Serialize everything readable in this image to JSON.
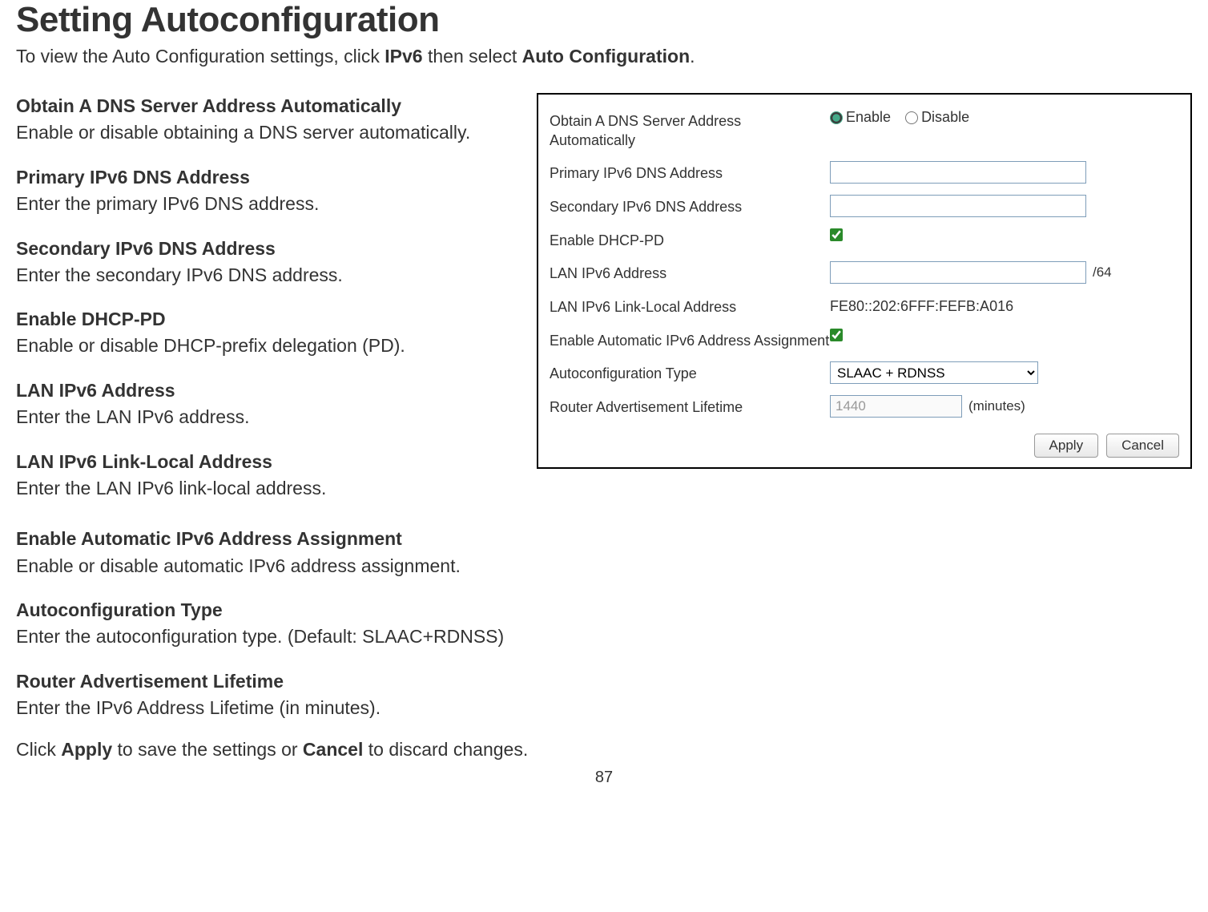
{
  "page": {
    "title": "Setting Autoconfiguration",
    "intro_prefix": "To view the Auto Configuration settings, click ",
    "intro_strong1": "IPv6",
    "intro_mid": " then select ",
    "intro_strong2": "Auto Configuration",
    "intro_suffix": ".",
    "page_number": "87"
  },
  "definitions": [
    {
      "term": "Obtain A DNS Server Address Automatically",
      "desc": "Enable or disable obtaining a DNS server automatically."
    },
    {
      "term": "Primary IPv6 DNS Address",
      "desc": "Enter the primary IPv6 DNS address."
    },
    {
      "term": "Secondary IPv6 DNS Address",
      "desc": "Enter the secondary IPv6 DNS address."
    },
    {
      "term": "Enable DHCP-PD",
      "desc": "Enable or disable DHCP-prefix delegation (PD)."
    },
    {
      "term": "LAN IPv6 Address",
      "desc": "Enter the LAN IPv6 address."
    },
    {
      "term": "LAN IPv6 Link-Local Address",
      "desc": "Enter the LAN IPv6 link-local address."
    },
    {
      "term": "Enable Automatic IPv6 Address Assignment",
      "desc": "Enable or disable automatic IPv6 address assignment."
    },
    {
      "term": "Autoconfiguration Type",
      "desc": "Enter the autoconfiguration type. (Default: SLAAC+RDNSS)"
    },
    {
      "term": "Router Advertisement Lifetime",
      "desc": "Enter the IPv6 Address Lifetime (in minutes)."
    }
  ],
  "footer": {
    "prefix": "Click ",
    "apply": "Apply",
    "mid": " to save the settings or ",
    "cancel": "Cancel",
    "suffix": " to discard changes."
  },
  "config": {
    "obtain_dns_label": "Obtain A DNS Server Address Automatically",
    "enable_label": "Enable",
    "disable_label": "Disable",
    "obtain_dns_value": "enable",
    "primary_dns_label": "Primary IPv6 DNS Address",
    "primary_dns_value": "",
    "secondary_dns_label": "Secondary IPv6 DNS Address",
    "secondary_dns_value": "",
    "dhcp_pd_label": "Enable DHCP-PD",
    "dhcp_pd_checked": true,
    "lan_ipv6_label": "LAN IPv6 Address",
    "lan_ipv6_value": "",
    "lan_ipv6_suffix": "/64",
    "link_local_label": "LAN IPv6 Link-Local Address",
    "link_local_value": "FE80::202:6FFF:FEFB:A016",
    "auto_assign_label": "Enable Automatic IPv6 Address Assignment",
    "auto_assign_checked": true,
    "autoconfig_type_label": "Autoconfiguration Type",
    "autoconfig_type_value": "SLAAC + RDNSS",
    "ra_lifetime_label": "Router Advertisement Lifetime",
    "ra_lifetime_value": "1440",
    "ra_lifetime_unit": "(minutes)",
    "apply_button": "Apply",
    "cancel_button": "Cancel"
  }
}
